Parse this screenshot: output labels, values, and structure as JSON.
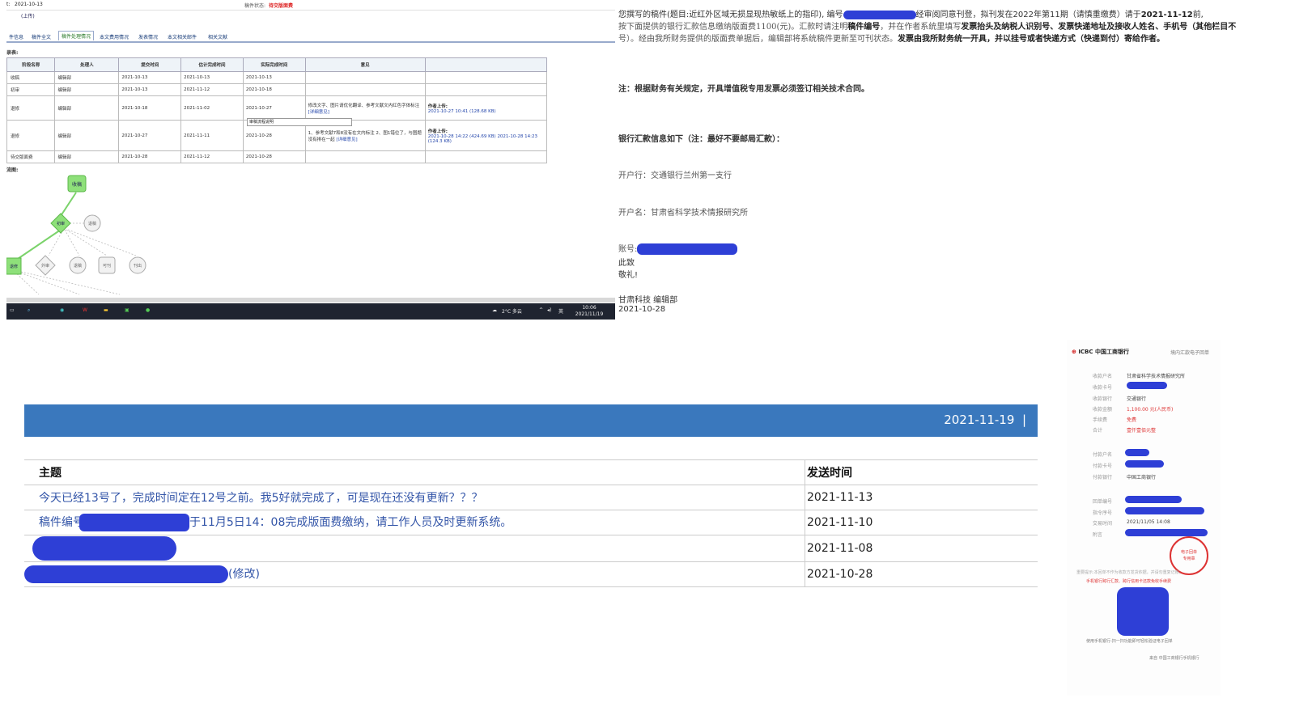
{
  "system_panel": {
    "submit_date_label": "t:",
    "submit_date": "2021-10-13",
    "upload_label": "(上传)",
    "status_label": "稿件状态:",
    "status_value": "待交版面费",
    "tabs": [
      "件信息",
      "稿件全文",
      "稿件处理情况",
      "本文费用情况",
      "发表情况",
      "本文相关邮件",
      "相关文献"
    ],
    "active_tab_index": 2,
    "record_label": "录表:",
    "table_headers": [
      "阶段名称",
      "处理人",
      "提交时间",
      "估计完成时间",
      "实际完成时间",
      "意见",
      ""
    ],
    "rows": [
      {
        "stage": "收稿",
        "handler": "编辑部",
        "submit": "2021-10-13",
        "estimate": "2021-10-13",
        "actual": "2021-10-13",
        "opinion": "",
        "upload": ""
      },
      {
        "stage": "初审",
        "handler": "编辑部",
        "submit": "2021-10-13",
        "estimate": "2021-11-12",
        "actual": "2021-10-18",
        "opinion": "",
        "upload": ""
      },
      {
        "stage": "退修",
        "handler": "编辑部",
        "submit": "2021-10-18",
        "estimate": "2021-11-02",
        "actual": "2021-10-27",
        "opinion": "修改文字、图片请优化翻译、参考文献文内红色字体标注",
        "opinion_link": "[详细意见]",
        "upload_label": "作者上传:",
        "upload": "2021-10-27 10:41 (128.68 KB)"
      },
      {
        "stage": "退修",
        "handler": "编辑部",
        "submit": "2021-10-27",
        "estimate": "2021-11-11",
        "actual": "2021-10-28",
        "opinion": "1、参考文献7和8没有在文内标注 2、图1错位了，与图题 没有排在一起",
        "opinion_link": "[详细意见]",
        "upload_label": "作者上传:",
        "upload": "2021-10-28 14:22 (424.69 KB)",
        "upload2": "2021-10-28 14:23 (124.3 KB)"
      },
      {
        "stage": "待交版面费",
        "handler": "编辑部",
        "submit": "2021-10-28",
        "estimate": "2021-11-12",
        "actual": "2021-10-28",
        "opinion": "",
        "upload": ""
      }
    ],
    "tooltip": "审稿流程说明",
    "diagram_label": "流图:",
    "diagram_nodes": [
      "收稿",
      "初审",
      "退稿",
      "退修",
      "外审",
      "退稿",
      "可刊",
      "刊出"
    ],
    "taskbar": {
      "weather": "2°C 多云",
      "ime": "英",
      "time": "10:06",
      "date": "2021/11/19"
    }
  },
  "letter": {
    "line1_a": "您撰写的稿件(题目:近红外区域无损显现热敏纸上的指印), 编号",
    "line1_b": "经审阅同意刊登，拟刊发在2022年第11期（请慎重缴费）请于",
    "line1_deadline": "2021-11-12",
    "line1_c": "前,",
    "line2_a": "按下面提供的银行汇款信息缴纳版面费1100(元)。汇款时请注明",
    "line2_b": "稿件编号",
    "line2_c": "，并在作者系统里填写",
    "line2_d": "发票抬头及纳税人识别号、发票快递地址及接收人姓名、手机号（其他栏目不",
    "line3_a": "号）。经由我所财务提供的版面费单据后，编辑部将系统稿件更新至可刊状态。",
    "line3_b": "发票由我所财务统一开具，并以挂号或者快递方式（快递到付）寄给作者。",
    "note": "注：根据财务有关规定，开具增值税专用发票必须签订相关技术合同。",
    "bank_heading": "银行汇款信息如下（注：最好不要邮局汇款）：",
    "bank_name": "开户行：交通银行兰州第一支行",
    "account_name": "开户名：甘肃省科学技术情报研究所",
    "account_no_label": "账号:",
    "closing1": "此致",
    "closing2": "敬礼!",
    "signature": "甘肃科技 编辑部",
    "sign_date": "2021-10-28"
  },
  "messages": {
    "header_date": "2021-11-19",
    "header_sep": "|",
    "col_subject": "主题",
    "col_time": "发送时间",
    "rows": [
      {
        "subject": "今天已经13号了，完成时间定在12号之前。我5好就完成了，可是现在还没有更新？？？",
        "time": "2021-11-13"
      },
      {
        "subject_prefix": "稿件编号",
        "subject": "于11月5日14：08完成版面费缴纳，请工作人员及时更新系统。",
        "time": "2021-11-10"
      },
      {
        "subject": "",
        "time": "2021-11-08"
      },
      {
        "subject": "(修改)",
        "time": "2021-10-28"
      }
    ]
  },
  "receipt": {
    "bank_logo": "ICBC 中国工商银行",
    "title": "境内汇款电子回单",
    "payee_name_label": "收款户名",
    "payee_name": "甘肃省科学技术情报研究所",
    "payee_card_label": "收款卡号",
    "payee_bank_label": "收款银行",
    "payee_bank": "交通银行",
    "amount_label": "收款金额",
    "amount": "1,100.00 元(人民币)",
    "fee_label": "手续费",
    "fee": "免费",
    "total_label": "合计",
    "total": "壹仟壹佰元整",
    "payer_name_label": "付款户名",
    "payer_card_label": "付款卡号",
    "payer_bank_label": "付款银行",
    "payer_bank": "中国工商银行",
    "receipt_no_label": "回单编号",
    "order_no_label": "指令序号",
    "trade_time_label": "交易时间",
    "trade_time": "2021/11/05 14:08",
    "memo_label": "附言",
    "stamp": "中国工商银行 电子回单 专用章",
    "notice": "重要提示:本回单不作为收款方发货依据，并请勿重复记账。",
    "promo": "手机银行跨行汇款、跨行信用卡还款免收手续费",
    "qr_hint": "使用手机银行-扫一扫功能即可轻松验证电子回单",
    "source": "来自 中国工商银行手机银行"
  }
}
